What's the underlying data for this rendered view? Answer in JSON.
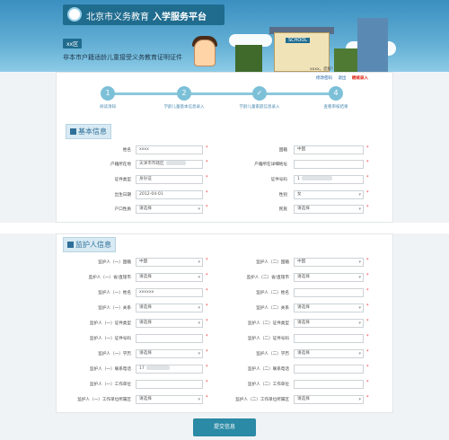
{
  "header": {
    "title_main": "北京市义务教育",
    "title_bold": "入学服务平台",
    "district": "xx区",
    "subtitle": "非本市户籍适龄儿童接受义务教育证明证件",
    "school_tag": "SCHOOL"
  },
  "user_bar": {
    "greeting": "xxxx，您好!",
    "links": [
      "修改密码",
      "退出"
    ],
    "register_link": "继续录入"
  },
  "steps": [
    {
      "num": "1",
      "label": "阅读须知"
    },
    {
      "num": "2",
      "label": "学龄儿童基本信息录入"
    },
    {
      "num": "✓",
      "label": "学龄儿童家庭信息录入"
    },
    {
      "num": "4",
      "label": "查看审核结果"
    }
  ],
  "basic_section": {
    "title": "基本信息",
    "fields": [
      {
        "label": "姓名",
        "value": "xxxx",
        "select": false
      },
      {
        "label": "国籍",
        "value": "中国",
        "select": false
      },
      {
        "label": "户籍所在地",
        "value": "天津市市辖区",
        "select": false
      },
      {
        "label": "户籍所在详细地址",
        "value": "",
        "select": false
      },
      {
        "label": "证件类型",
        "value": "身份证",
        "select": false
      },
      {
        "label": "证件号码",
        "value": "1",
        "select": false
      },
      {
        "label": "出生日期",
        "value": "2012-04-01",
        "select": false
      },
      {
        "label": "性别",
        "value": "女",
        "select": true
      },
      {
        "label": "户口性质",
        "value": "请选择",
        "select": true
      },
      {
        "label": "民族",
        "value": "请选择",
        "select": true
      }
    ]
  },
  "guardian_section": {
    "title": "监护人信息",
    "left": [
      {
        "label": "监护人（一）国籍",
        "value": "中国",
        "select": true
      },
      {
        "label": "监护人（一）省/直辖市",
        "value": "请选择",
        "select": true
      },
      {
        "label": "监护人（一）姓名",
        "value": "xxxxxx",
        "select": false
      },
      {
        "label": "监护人（一）关系",
        "value": "请选择",
        "select": true
      },
      {
        "label": "监护人（一）证件类型",
        "value": "请选择",
        "select": true
      },
      {
        "label": "监护人（一）证件号码",
        "value": "",
        "select": false
      },
      {
        "label": "监护人（一）学历",
        "value": "请选择",
        "select": true
      },
      {
        "label": "监护人（一）联系电话",
        "value": "17",
        "select": false
      },
      {
        "label": "监护人（一）工作单位",
        "value": "",
        "select": false
      },
      {
        "label": "监护人（一）工作单位所属区",
        "value": "请选择",
        "select": true
      }
    ],
    "right": [
      {
        "label": "监护人（二）国籍",
        "value": "中国",
        "select": true
      },
      {
        "label": "监护人（二）省/直辖市",
        "value": "请选择",
        "select": true
      },
      {
        "label": "监护人（二）姓名",
        "value": "",
        "select": false
      },
      {
        "label": "监护人（二）关系",
        "value": "请选择",
        "select": true
      },
      {
        "label": "监护人（二）证件类型",
        "value": "请选择",
        "select": true
      },
      {
        "label": "监护人（二）证件号码",
        "value": "",
        "select": false
      },
      {
        "label": "监护人（二）学历",
        "value": "请选择",
        "select": true
      },
      {
        "label": "监护人（二）联系电话",
        "value": "",
        "select": false
      },
      {
        "label": "监护人（二）工作单位",
        "value": "",
        "select": false
      },
      {
        "label": "监护人（二）工作单位所属区",
        "value": "请选择",
        "select": true
      }
    ]
  },
  "submit_label": "提交信息",
  "colors": {
    "primary": "#2b8aa5",
    "step": "#7cc0d8",
    "required": "#ee3322"
  }
}
